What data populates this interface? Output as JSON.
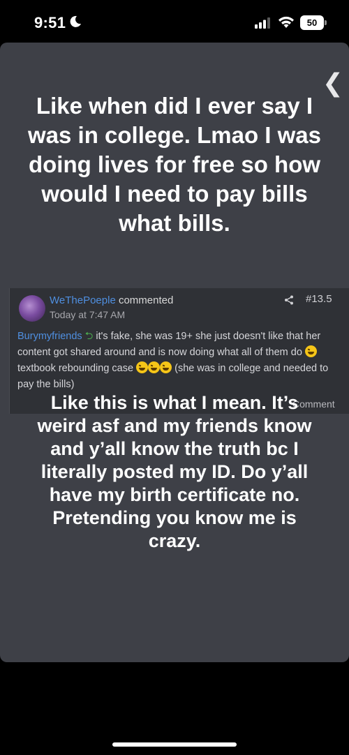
{
  "status_bar": {
    "time": "9:51",
    "battery": "50",
    "icons": [
      "moon-icon",
      "signal-icon",
      "wifi-icon",
      "battery-icon"
    ]
  },
  "story": {
    "back_glyph": "❮",
    "caption_top": "Like when did I ever say I was in college. Lmao I was doing lives for free so how would I need to pay bills what bills.",
    "caption_bottom": "Like this is what I mean. It’s weird asf and my friends know and y’all know the truth bc I literally posted my ID. Do y’all have my birth certificate no. Pretending you know me is crazy."
  },
  "comment": {
    "username": "WeThePoeple",
    "verb": "commented",
    "timestamp": "Today at 7:47 AM",
    "post_number": "#13.5",
    "mention": "Burymyfriends",
    "reply_icon": "reply-arrow-icon",
    "text_part1": "it's fake, she was 19+ she just doesn't like that her content got shared around and is now doing what all of them do",
    "text_part2": "textbook rebounding case",
    "text_part3": "(she was in college and needed to pay the bills)",
    "action_label": "Comment"
  },
  "colors": {
    "background": "#000000",
    "card": "#3e4047",
    "comment_bg": "#2f3136",
    "link_blue": "#4f8fe0",
    "reply_green": "#4caf50"
  }
}
